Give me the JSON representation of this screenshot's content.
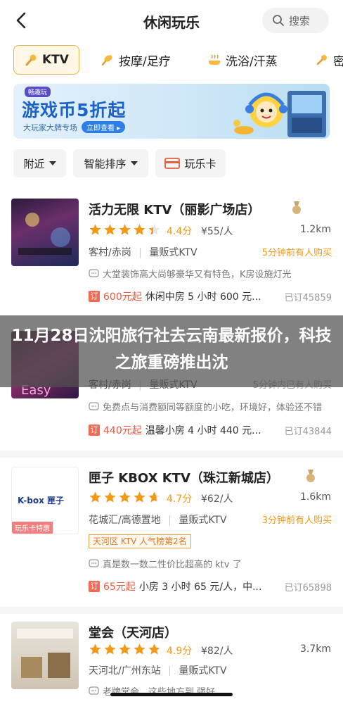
{
  "header": {
    "title": "休闲玩乐",
    "search_placeholder": "搜索"
  },
  "categories": [
    {
      "label": "KTV",
      "icon": "mic-icon",
      "active": true
    },
    {
      "label": "按摩/足疗",
      "icon": "massage-icon",
      "active": false
    },
    {
      "label": "洗浴/汗蒸",
      "icon": "bath-icon",
      "active": false
    },
    {
      "label": "密",
      "icon": "key-icon",
      "active": false
    }
  ],
  "banner": {
    "badge": "畅趣玩",
    "headline": "游戏币5折起",
    "sub": "大玩家大牌专场",
    "cta": "立即查看 ▸"
  },
  "filters": {
    "nearby": "附近",
    "sort": "智能排序",
    "card": "玩乐卡"
  },
  "listings": [
    {
      "name": "活力无限 KTV（丽影广场店）",
      "rating": "4.4分",
      "rating_value": 4.4,
      "price": "¥55/人",
      "distance": "1.2km",
      "area": "客村/赤岗",
      "category": "量贩式KTV",
      "recent": "5分钟前有人购买",
      "review": "大堂装饰高大尚够豪华又有特色，K房设施灯光",
      "deal_icon": "订",
      "deal_price": "600元起",
      "deal_desc": "休闲中房 5 小时 600 元...",
      "deal_sold": "已订45859"
    },
    {
      "area": "客村/赤岗",
      "category": "量贩式KTV",
      "recent": "5分钟内已有人购买",
      "review": "免费点与消费额同等额度的小吃，环境好，体验还不错",
      "deal_icon": "订",
      "deal_price": "440元起",
      "deal_desc": "温馨小房 4 小时 440 元...",
      "deal_sold": "已订43844"
    },
    {
      "name": "匣子 KBOX KTV（珠江新城店）",
      "thumb_tag": "玩乐卡特惠",
      "thumb_logo": "K-box 匣子",
      "rating": "4.7分",
      "rating_value": 4.7,
      "price": "¥62/人",
      "distance": "1.6km",
      "area": "花城汇/高德置地",
      "category": "量贩式KTV",
      "recent": "3分钟前有人购买",
      "rank": "天河区 KTV 人气榜第2名",
      "review": "真是数一数二性价比超高的 ktv 了",
      "deal_icon": "订",
      "deal_price": "65元起",
      "deal_desc": "小房 3 小时 65 元/人，中...",
      "deal_sold": "已订65898"
    },
    {
      "name": "堂会（天河店）",
      "rating": "4.9分",
      "rating_value": 4.9,
      "price": "¥82/人",
      "distance": "3.7km",
      "area": "天河北/广州东站",
      "category": "量贩式KTV",
      "review": "老牌堂会，这些地方到 强好"
    }
  ],
  "overlay": {
    "text": "11月28日沈阳旅行社去云南最新报价，科技之旅重磅推出沈"
  },
  "colors": {
    "accent": "#f09a17",
    "deal": "#f0573c",
    "banner_blue": "#1d63c7"
  }
}
